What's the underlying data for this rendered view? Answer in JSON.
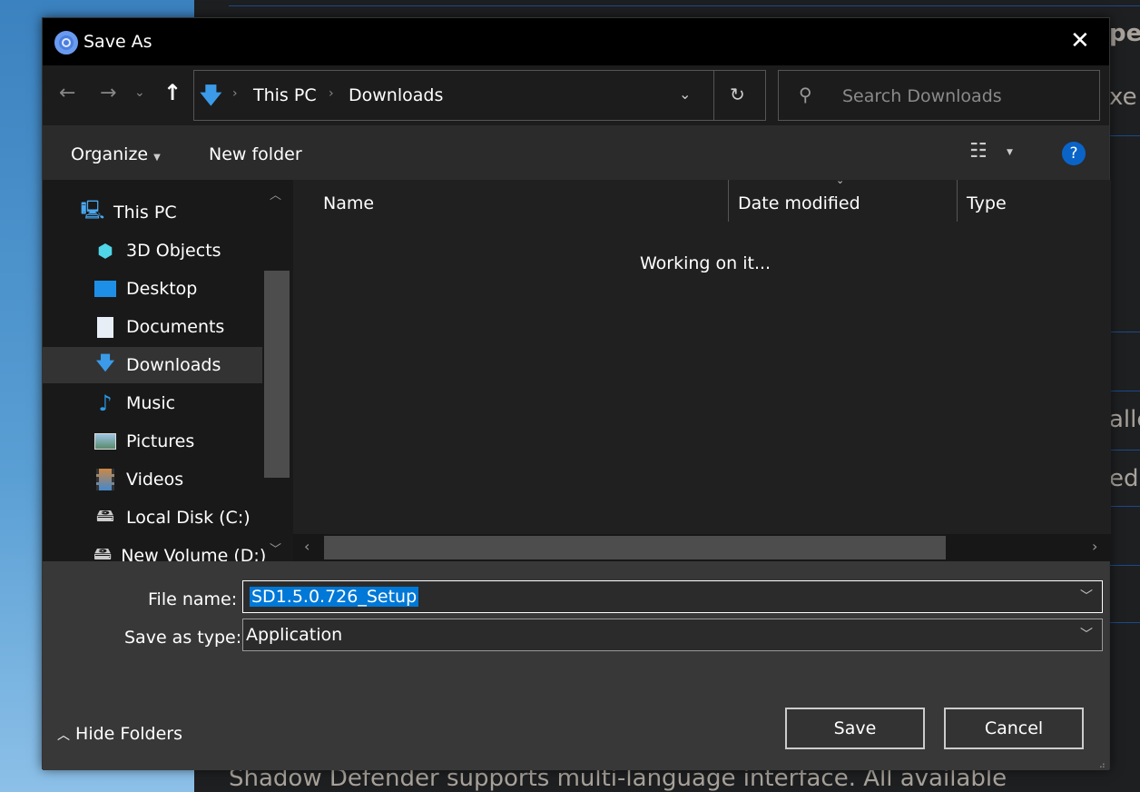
{
  "background": {
    "fragments": [
      "pe",
      "xe",
      "alle",
      "ed"
    ],
    "bottom_text": "Shadow Defender supports multi-language interface. All available"
  },
  "dialog": {
    "title": "Save As",
    "address": {
      "crumbs": [
        "This PC",
        "Downloads"
      ]
    },
    "search": {
      "placeholder": "Search Downloads"
    },
    "toolbar": {
      "organize": "Organize",
      "new_folder": "New folder",
      "help": "?"
    },
    "nav": {
      "items": [
        {
          "label": "This PC",
          "icon": "computer-icon"
        },
        {
          "label": "3D Objects",
          "icon": "cube-icon"
        },
        {
          "label": "Desktop",
          "icon": "desktop-icon"
        },
        {
          "label": "Documents",
          "icon": "document-icon"
        },
        {
          "label": "Downloads",
          "icon": "download-icon",
          "selected": true
        },
        {
          "label": "Music",
          "icon": "music-note-icon"
        },
        {
          "label": "Pictures",
          "icon": "picture-icon"
        },
        {
          "label": "Videos",
          "icon": "video-icon"
        },
        {
          "label": "Local Disk (C:)",
          "icon": "drive-icon"
        },
        {
          "label": "New Volume (D:)",
          "icon": "drive-icon"
        }
      ]
    },
    "columns": [
      "Name",
      "Date modified",
      "Type"
    ],
    "status": "Working on it...",
    "form": {
      "file_name_label": "File name:",
      "file_name": "SD1.5.0.726_Setup",
      "type_label": "Save as type:",
      "type": "Application"
    },
    "hide_folders": "Hide Folders",
    "save": "Save",
    "cancel": "Cancel",
    "colors": {
      "accent": "#0078d7",
      "selection": "#0078d7"
    }
  }
}
